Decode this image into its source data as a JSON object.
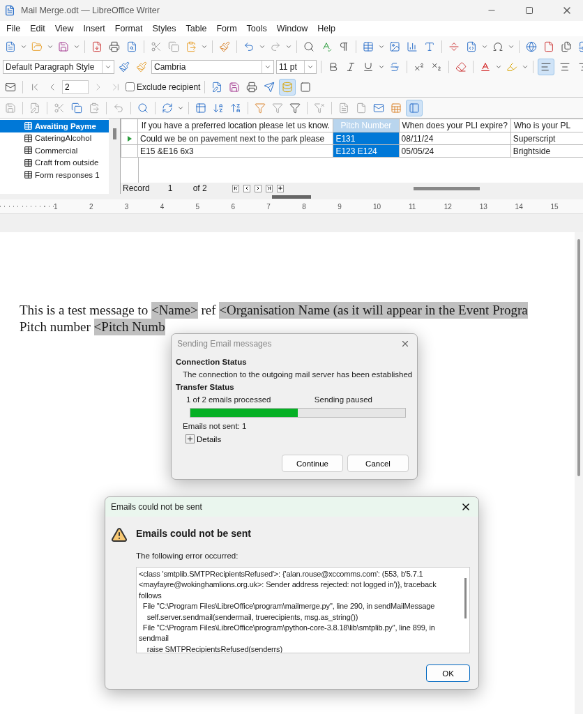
{
  "window": {
    "title": "Mail Merge.odt — LibreOffice Writer"
  },
  "menu": [
    "File",
    "Edit",
    "View",
    "Insert",
    "Format",
    "Styles",
    "Table",
    "Form",
    "Tools",
    "Window",
    "Help"
  ],
  "formatting": {
    "paragraph_style": "Default Paragraph Style",
    "font": "Cambria",
    "size": "11 pt",
    "alignment": [
      {
        "selected": true
      },
      {
        "selected": false
      },
      {
        "selected": false
      }
    ]
  },
  "mail_merge_toolbar": {
    "record": "2",
    "exclude_recipient": {
      "label": "Exclude recipient",
      "checked": false
    },
    "data_source_on": true
  },
  "data_toolbar": {
    "explorer_on": true
  },
  "data_sources": {
    "tables": [
      {
        "label": "Awaiting Payme",
        "selected": true
      },
      {
        "label": "CateringAlcohol",
        "selected": false
      },
      {
        "label": "Commercial",
        "selected": false
      },
      {
        "label": "Craft from outside",
        "selected": false
      },
      {
        "label": "Form responses 1",
        "selected": false
      }
    ]
  },
  "grid": {
    "columns": [
      {
        "label": "If you have a preferred location please let us know.",
        "selected": false
      },
      {
        "label": "Pitch Number",
        "selected": true
      },
      {
        "label": "When does your PLI expire?",
        "selected": false
      },
      {
        "label": "Who is your PL",
        "selected": false
      }
    ],
    "rows": [
      {
        "current": true,
        "cells": [
          "Could we be on pavement next to the park please",
          "E131",
          "08/11/24",
          "Superscript"
        ]
      },
      {
        "current": false,
        "cells": [
          "E15 &E16  6x3",
          "E123  E124",
          "05/05/24",
          "Brightside"
        ]
      }
    ],
    "record_label": "Record",
    "record": "1",
    "record_count": "of 2"
  },
  "ruler": {
    "marks": [
      "1",
      "2",
      "3",
      "4",
      "5",
      "6",
      "7",
      "8",
      "9",
      "10",
      "11",
      "12",
      "13",
      "14",
      "15"
    ]
  },
  "document": {
    "lines": [
      [
        {
          "kind": "text",
          "text": "This is a test message to "
        },
        {
          "kind": "field",
          "text": "<Name>"
        },
        {
          "kind": "text",
          "text": " ref "
        },
        {
          "kind": "field",
          "text": "<Organisation Name (as it will appear in the Event Progra"
        }
      ],
      [
        {
          "kind": "text",
          "text": "Pitch number "
        },
        {
          "kind": "field",
          "text": "<Pitch Numb"
        }
      ]
    ]
  },
  "sending_dialog": {
    "title": "Sending Email messages",
    "connection_heading": "Connection Status",
    "connection_text": "The connection to the outgoing mail server has been established",
    "transfer_heading": "Transfer Status",
    "processed": "1 of 2 emails processed",
    "status": "Sending paused",
    "level": 0.5,
    "not_sent": "Emails not sent: 1",
    "details": {
      "label": "Details",
      "expanded": false
    },
    "buttons": [
      "Continue",
      "Cancel"
    ]
  },
  "error_dialog": {
    "title": "Emails could not be sent",
    "heading": "Emails could not be sent",
    "intro": "The following error occurred:",
    "details": "<class 'smtplib.SMTPRecipientsRefused'>: {'alan.rouse@xccomms.com': (553, b'5.7.1 <mayfayre@wokinghamlions.org.uk>: Sender address rejected: not logged in')}, traceback follows\n  File \"C:\\Program Files\\LibreOffice\\program\\mailmerge.py\", line 290, in sendMailMessage\n    self.server.sendmail(sendermail, truerecipients, msg.as_string())\n  File \"C:\\Program Files\\LibreOffice\\program\\python-core-3.8.18\\lib\\smtplib.py\", line 899, in sendmail\n    raise SMTPRecipientsRefused(senderrs)",
    "button": "OK"
  }
}
